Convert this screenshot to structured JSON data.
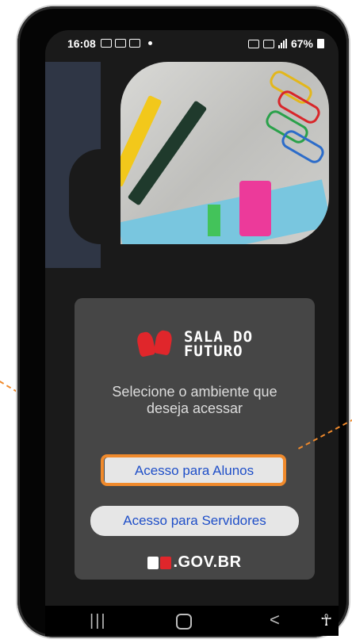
{
  "status_bar": {
    "time": "16:08",
    "battery": "67%"
  },
  "card": {
    "logo_line1": "SALA DO",
    "logo_line2": "FUTURO",
    "prompt_line1": "Selecione o ambiente que",
    "prompt_line2": "deseja acessar",
    "button_alunos": "Acesso para Alunos",
    "button_servidores": "Acesso para Servidores",
    "gov_text": ".GOV.BR"
  },
  "nav_bar": {
    "recent_glyph": "|||",
    "back_glyph": "<",
    "accessibility_glyph": "☥"
  },
  "colors": {
    "highlight": "#f08a2c",
    "button_text": "#1f4fc8",
    "card_bg": "#464646",
    "logo_red": "#e0262b"
  }
}
